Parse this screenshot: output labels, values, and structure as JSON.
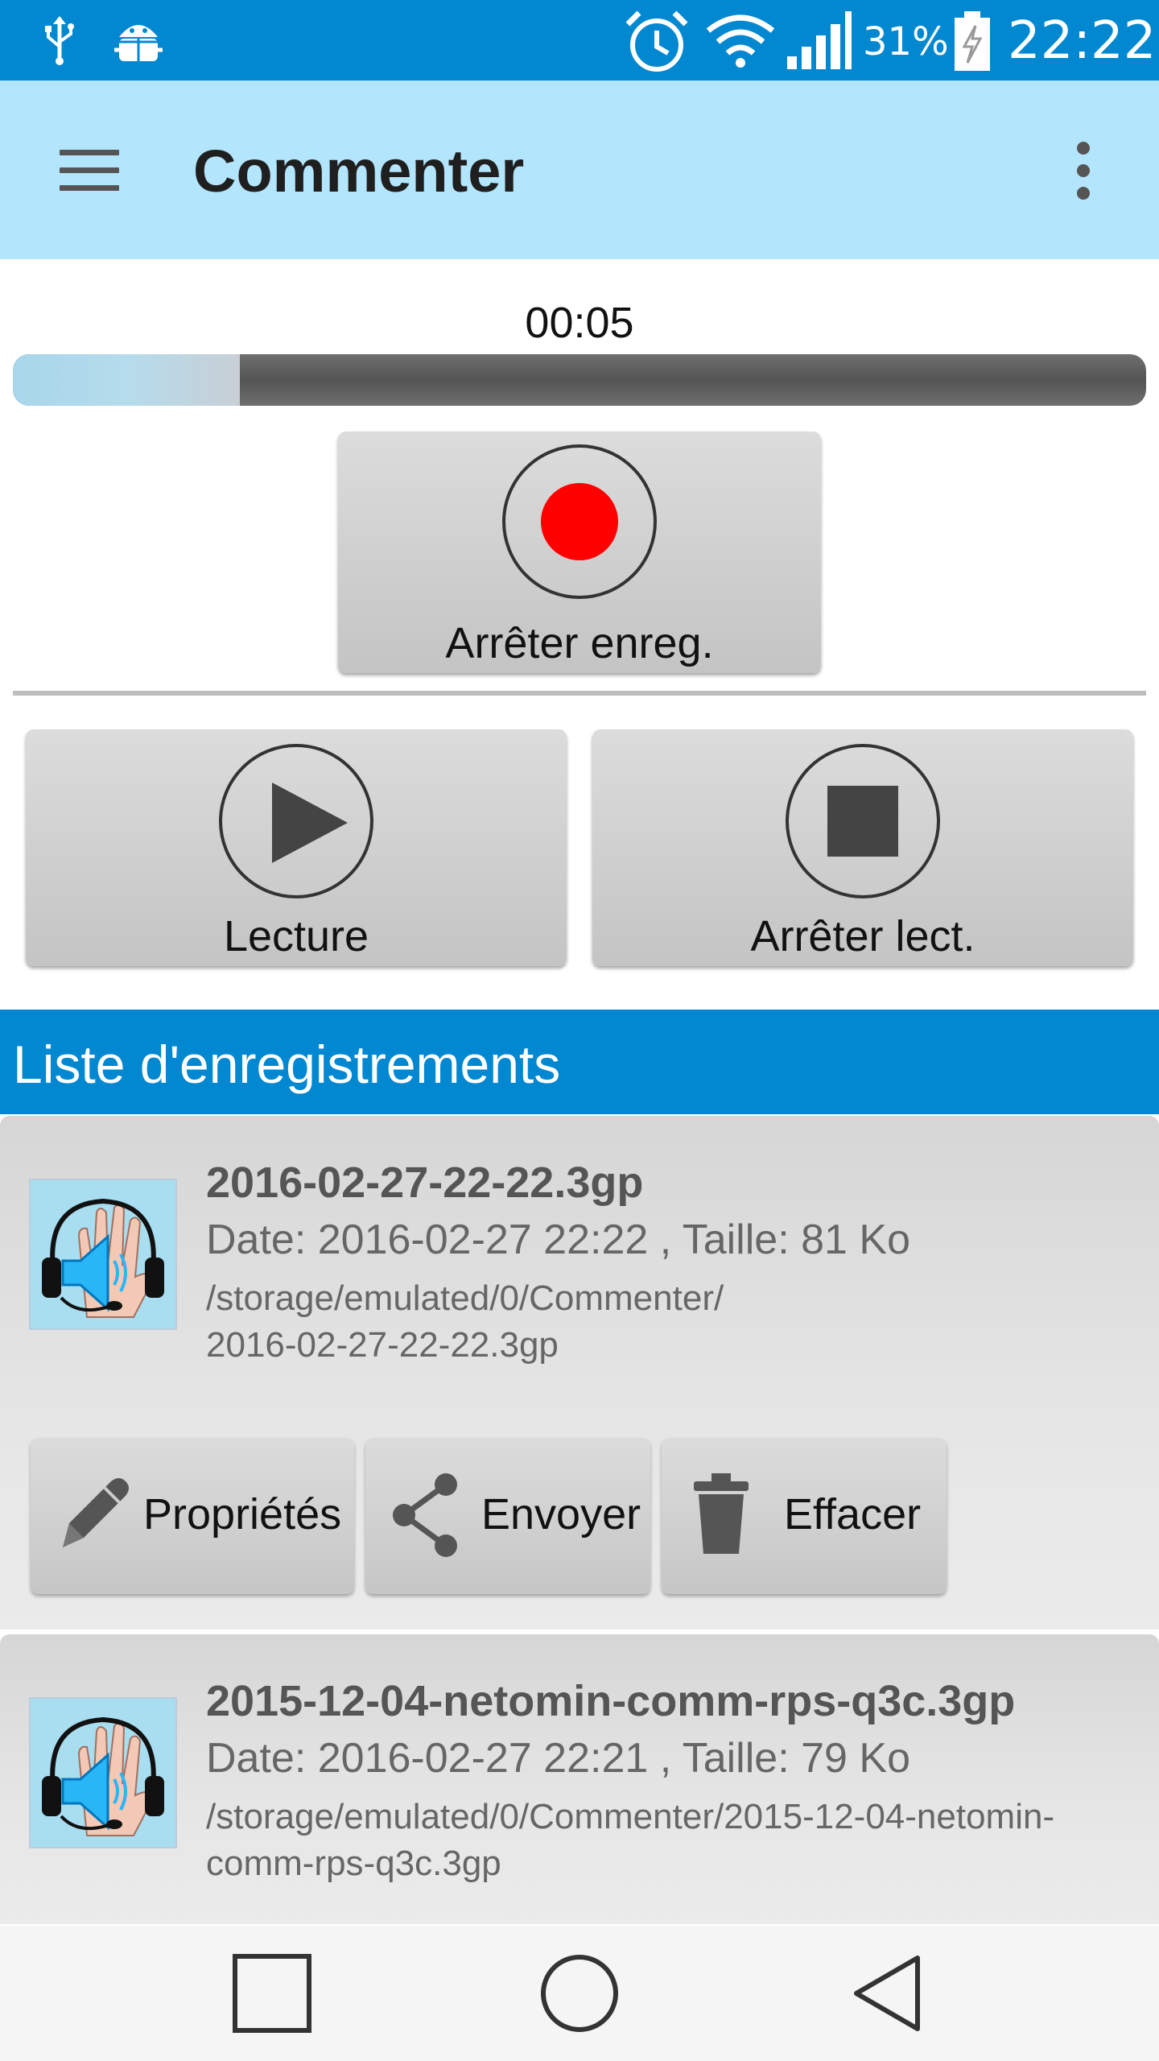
{
  "status_bar": {
    "battery_percent": "31%",
    "time": "22:22",
    "icons": [
      "usb-icon",
      "android-debug-icon",
      "alarm-icon",
      "wifi-icon",
      "signal-icon",
      "battery-charging-icon"
    ]
  },
  "app_bar": {
    "title": "Commenter"
  },
  "recorder": {
    "timer": "00:05",
    "progress_fraction": 0.2,
    "record_button_label": "Arrêter enreg.",
    "play_button_label": "Lecture",
    "stop_button_label": "Arrêter lect."
  },
  "list": {
    "header": "Liste d'enregistrements",
    "items": [
      {
        "name": "2016-02-27-22-22.3gp",
        "meta": "Date: 2016-02-27 22:22 , Taille: 81 Ko",
        "path_line1": "/storage/emulated/0/Commenter/",
        "path_line2": "2016-02-27-22-22.3gp",
        "actions": {
          "properties": "Propriétés",
          "send": "Envoyer",
          "delete": "Effacer"
        }
      },
      {
        "name": "2015-12-04-netomin-comm-rps-q3c.3gp",
        "meta": "Date: 2016-02-27 22:21 , Taille: 79 Ko",
        "path_line1": "/storage/emulated/0/Commenter/2015-12-04-netomin-",
        "path_line2": "comm-rps-q3c.3gp"
      }
    ]
  },
  "colors": {
    "status_bar": "#0288d1",
    "app_bar": "#b3e5fc",
    "list_header": "#0288d1",
    "record_dot": "#ff0000"
  }
}
